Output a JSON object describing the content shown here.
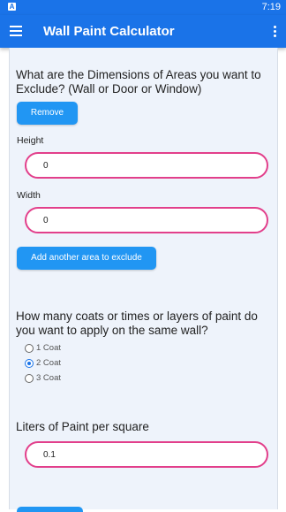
{
  "status_bar": {
    "notification_letter": "A",
    "time": "7:19"
  },
  "app_bar": {
    "title": "Wall Paint Calculator"
  },
  "exclude_section": {
    "question": "What are the Dimensions of Areas you want to Exclude? (Wall or Door or Window)",
    "remove_label": "Remove",
    "height_label": "Height",
    "height_value": "0",
    "width_label": "Width",
    "width_value": "0",
    "add_area_label": "Add another area to exclude"
  },
  "coats_section": {
    "question": "How many coats or times or layers of paint do you want to apply on the same wall?",
    "options": [
      {
        "label": "1 Coat",
        "checked": false
      },
      {
        "label": "2 Coat",
        "checked": true
      },
      {
        "label": "3 Coat",
        "checked": false
      }
    ]
  },
  "liters_section": {
    "label": "Liters of Paint per square",
    "value": "0.1"
  },
  "colors": {
    "primary": "#1a73e8",
    "button": "#2196f3",
    "field_border": "#e23f8b"
  }
}
